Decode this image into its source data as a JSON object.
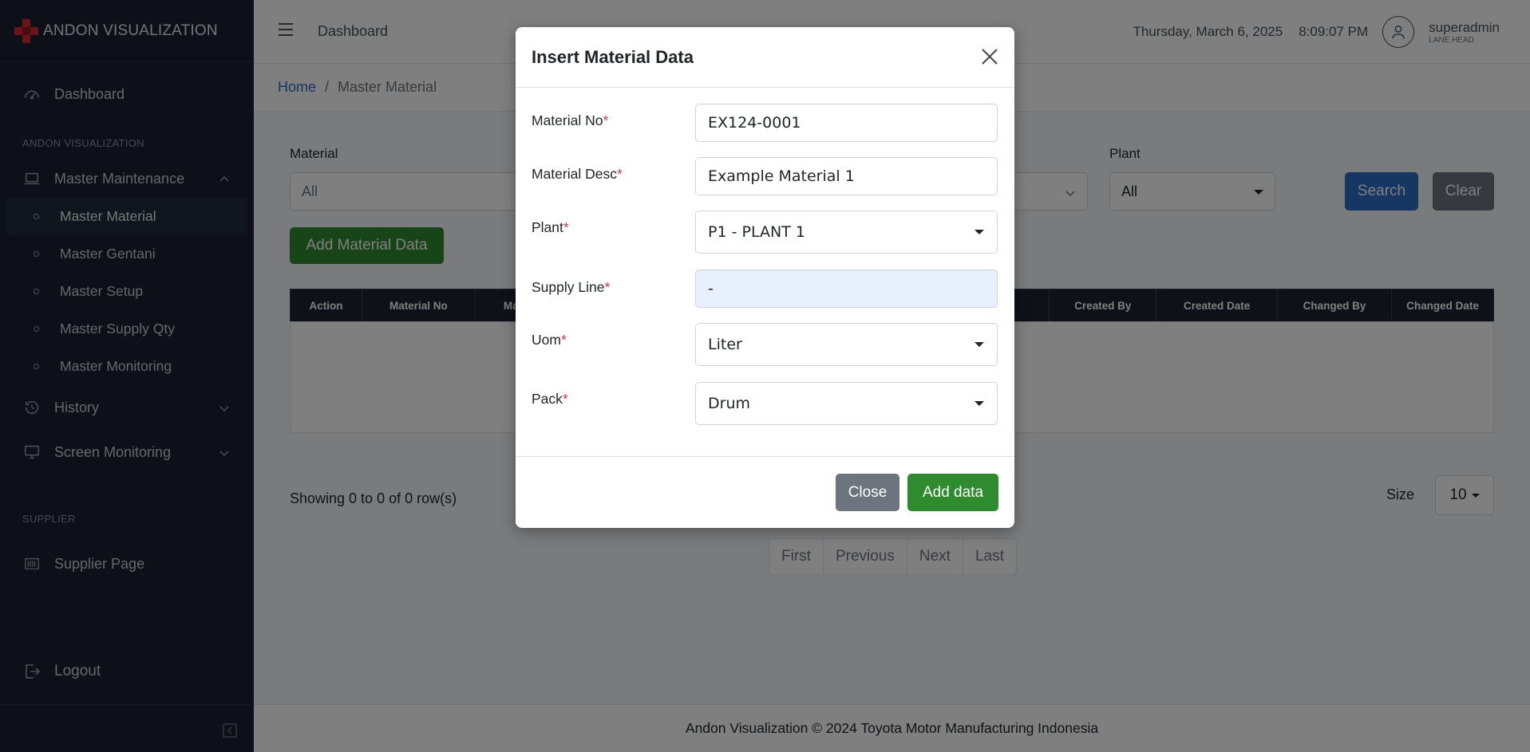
{
  "sidebar": {
    "brand": "ANDON VISUALIZATION",
    "dashboard": "Dashboard",
    "section1": "ANDON VISUALIZATION",
    "master_maintenance": "Master Maintenance",
    "sub_items": [
      "Master Material",
      "Master Gentani",
      "Master Setup",
      "Master Supply Qty",
      "Master Monitoring"
    ],
    "history": "History",
    "screen_monitoring": "Screen Monitoring",
    "section2": "SUPPLIER",
    "supplier_page": "Supplier Page",
    "logout": "Logout"
  },
  "topbar": {
    "title": "Dashboard",
    "date": "Thursday, March 6, 2025",
    "time": "8:09:07 PM",
    "user_name": "superadmin",
    "user_role": "LANE HEAD"
  },
  "breadcrumb": {
    "home": "Home",
    "separator": "/",
    "current": "Master Material"
  },
  "filters": {
    "material_label": "Material",
    "material_value": "All",
    "plant_label": "Plant",
    "plant_value": "All",
    "search_label": "Search",
    "clear_label": "Clear"
  },
  "add_button": "Add Material Data",
  "table": {
    "columns": [
      "Action",
      "Material No",
      "Ma",
      "Created By",
      "Created Date",
      "Changed By",
      "Changed Date"
    ]
  },
  "pagination": {
    "showing": "Showing 0 to 0 of 0 row(s)",
    "size_label": "Size",
    "size_value": "10",
    "pages": [
      "First",
      "Previous",
      "Next",
      "Last"
    ]
  },
  "footer": "Andon Visualization © 2024 Toyota Motor Manufacturing Indonesia",
  "modal": {
    "title": "Insert Material Data",
    "fields": {
      "material_no": {
        "label": "Material No",
        "value": "EX124-0001"
      },
      "material_desc": {
        "label": "Material Desc",
        "value": "Example Material 1"
      },
      "plant": {
        "label": "Plant",
        "value": "P1 - PLANT 1"
      },
      "supply_line": {
        "label": "Supply Line",
        "value": "-"
      },
      "uom": {
        "label": "Uom",
        "value": "Liter"
      },
      "pack": {
        "label": "Pack",
        "value": "Drum"
      }
    },
    "required_mark": "*",
    "close_label": "Close",
    "add_label": "Add data"
  },
  "colors": {
    "sidebar_bg": "#1a2130",
    "primary": "#2f6fc6",
    "success": "#2e8b2e",
    "secondary": "#6c757d",
    "danger": "#dc3545"
  }
}
